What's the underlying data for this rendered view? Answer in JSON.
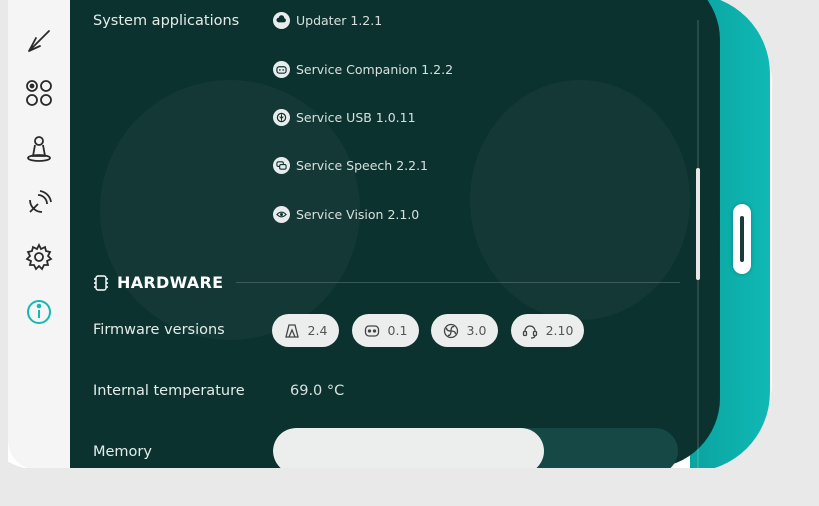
{
  "system_apps": {
    "label": "System applications",
    "items": [
      {
        "name": "Updater 1.2.1",
        "icon": "cloud-download-icon"
      },
      {
        "name": "Service Companion 1.2.2",
        "icon": "robot-face-icon"
      },
      {
        "name": "Service USB 1.0.11",
        "icon": "usb-icon"
      },
      {
        "name": "Service Speech 2.2.1",
        "icon": "speech-bubbles-icon"
      },
      {
        "name": "Service Vision 2.1.0",
        "icon": "eye-icon"
      }
    ]
  },
  "hardware": {
    "title": "HARDWARE",
    "firmware_label": "Firmware versions",
    "firmware": [
      {
        "version": "2.4",
        "icon": "chassis-icon"
      },
      {
        "version": "0.1",
        "icon": "face-icon"
      },
      {
        "version": "3.0",
        "icon": "fan-icon"
      },
      {
        "version": "2.10",
        "icon": "headset-icon"
      }
    ],
    "temperature_label": "Internal temperature",
    "temperature_value": "69.0 °C",
    "memory_label": "Memory",
    "memory_used_fraction": 0.67
  },
  "sidebar": {
    "items": [
      "back-icon",
      "apps-icon",
      "robot-icon",
      "connectivity-icon",
      "settings-icon",
      "info-icon"
    ],
    "active": "info-icon"
  },
  "colors": {
    "accent": "#10b9b4",
    "screen": "#0c3230",
    "active_icon": "#16b8b4"
  }
}
